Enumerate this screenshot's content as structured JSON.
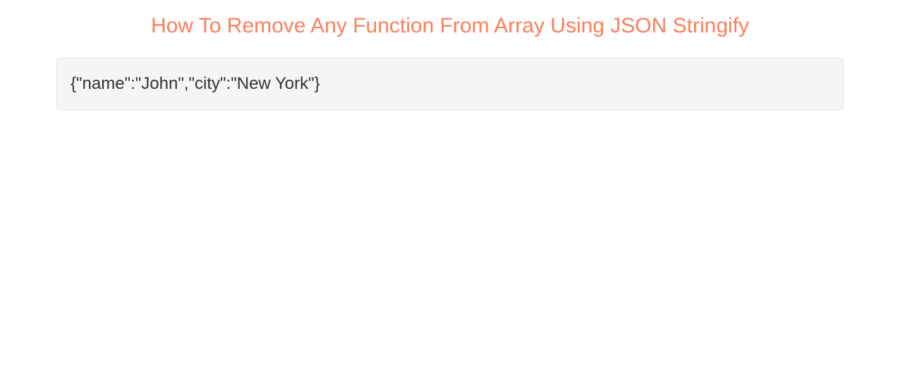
{
  "header": {
    "title": "How To Remove Any Function From Array Using JSON Stringify"
  },
  "output": {
    "text": "{\"name\":\"John\",\"city\":\"New York\"}"
  }
}
